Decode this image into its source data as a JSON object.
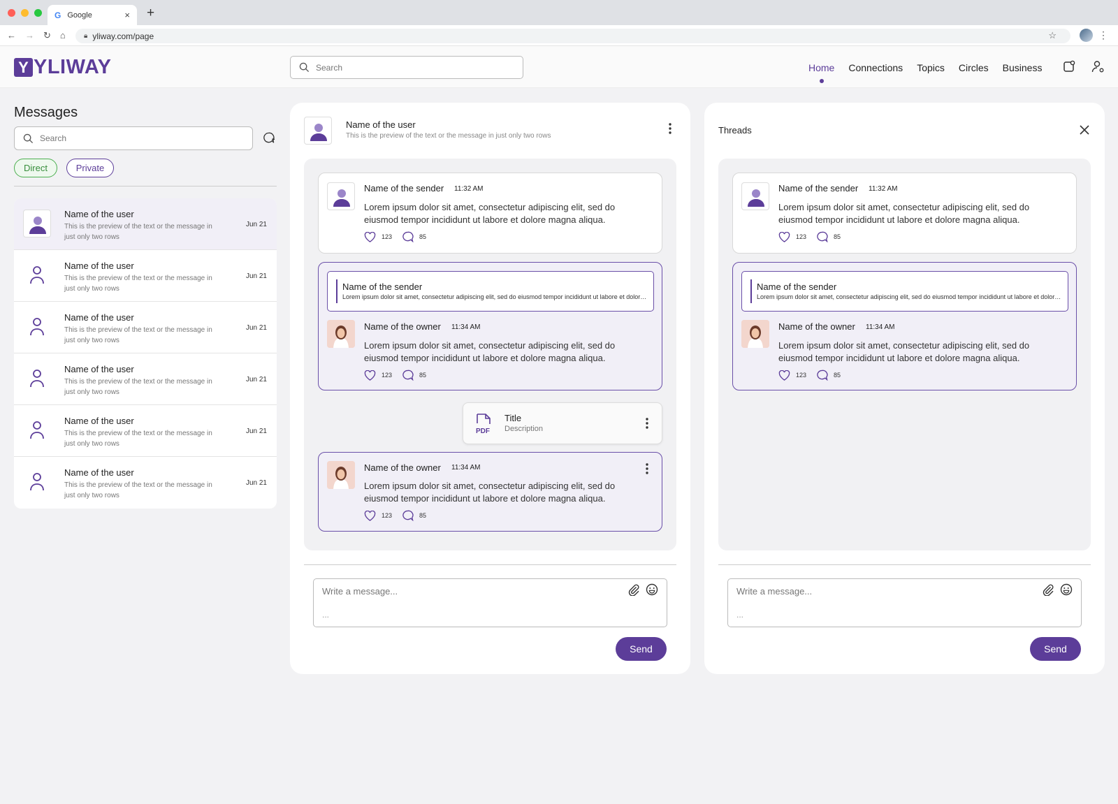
{
  "browser": {
    "tab_title": "Google",
    "tab_icon": "G",
    "url": "yliway.com/page",
    "traffic_light_colors": [
      "#ff5f57",
      "#febc2e",
      "#28c840"
    ]
  },
  "brand": {
    "logo_mark": "Y",
    "logo_word": "YLIWAY",
    "color": "#5c3d99"
  },
  "header": {
    "search_placeholder": "Search",
    "nav": [
      "Home",
      "Connections",
      "Topics",
      "Circles",
      "Business"
    ],
    "active_nav": "Home"
  },
  "messages": {
    "title": "Messages",
    "search_placeholder": "Search",
    "filters": [
      "Direct",
      "Private"
    ],
    "conversations": [
      {
        "name": "Name of the user",
        "preview": "This is the preview of the text or the message in just only two rows",
        "date": "Jun 21",
        "selected": true
      },
      {
        "name": "Name of the user",
        "preview": "This is the preview of the text or the message in just only two rows",
        "date": "Jun 21"
      },
      {
        "name": "Name of the user",
        "preview": "This is the preview of the text or the message in just only two rows",
        "date": "Jun 21"
      },
      {
        "name": "Name of the user",
        "preview": "This is the preview of the text or the message in just only two rows",
        "date": "Jun 21"
      },
      {
        "name": "Name of the user",
        "preview": "This is the preview of the text or the message in just only two rows",
        "date": "Jun 21"
      },
      {
        "name": "Name of the user",
        "preview": "This is the preview of the text or the message in just only two rows",
        "date": "Jun 21"
      }
    ]
  },
  "chat": {
    "user_name": "Name of the user",
    "user_preview": "This is the preview of the text or the message in just only two rows",
    "messages": [
      {
        "sender": "Name of the sender",
        "time": "11:32 AM",
        "text": "Lorem ipsum dolor sit amet, consectetur adipiscing elit, sed do eiusmod tempor incididunt ut labore et dolore magna aliqua.",
        "likes": "123",
        "comments": "85"
      },
      {
        "quote_name": "Name of the sender",
        "quote_text": "Lorem ipsum dolor sit amet, consectetur adipiscing elit, sed do eiusmod tempor incididunt ut labore et dolore magna aliqua.",
        "sender": "Name of the owner",
        "time": "11:34 AM",
        "text": "Lorem ipsum dolor sit amet, consectetur adipiscing elit, sed do eiusmod tempor incididunt ut labore et dolore magna aliqua.",
        "likes": "123",
        "comments": "85"
      },
      {
        "sender": "Name of the owner",
        "time": "11:34 AM",
        "text": "Lorem ipsum dolor sit amet, consectetur adipiscing elit, sed do eiusmod tempor incididunt ut labore et dolore magna aliqua.",
        "likes": "123",
        "comments": "85"
      }
    ],
    "file": {
      "icon_label": "PDF",
      "title": "Title",
      "description": "Description"
    },
    "composer_placeholder": "Write a message...",
    "composer_ellipsis": "...",
    "send_label": "Send"
  },
  "threads": {
    "title": "Threads",
    "messages": [
      {
        "sender": "Name of the sender",
        "time": "11:32 AM",
        "text": "Lorem ipsum dolor sit amet, consectetur adipiscing elit, sed do eiusmod tempor incididunt ut labore et dolore magna aliqua.",
        "likes": "123",
        "comments": "85"
      },
      {
        "quote_name": "Name of the sender",
        "quote_text": "Lorem ipsum dolor sit amet, consectetur adipiscing elit, sed do eiusmod tempor incididunt ut labore et dolore magna aliqua.",
        "sender": "Name of the owner",
        "time": "11:34 AM",
        "text": "Lorem ipsum dolor sit amet, consectetur adipiscing elit, sed do eiusmod tempor incididunt ut labore et dolore magna aliqua.",
        "likes": "123",
        "comments": "85"
      }
    ],
    "composer_placeholder": "Write a message...",
    "composer_ellipsis": "...",
    "send_label": "Send"
  }
}
